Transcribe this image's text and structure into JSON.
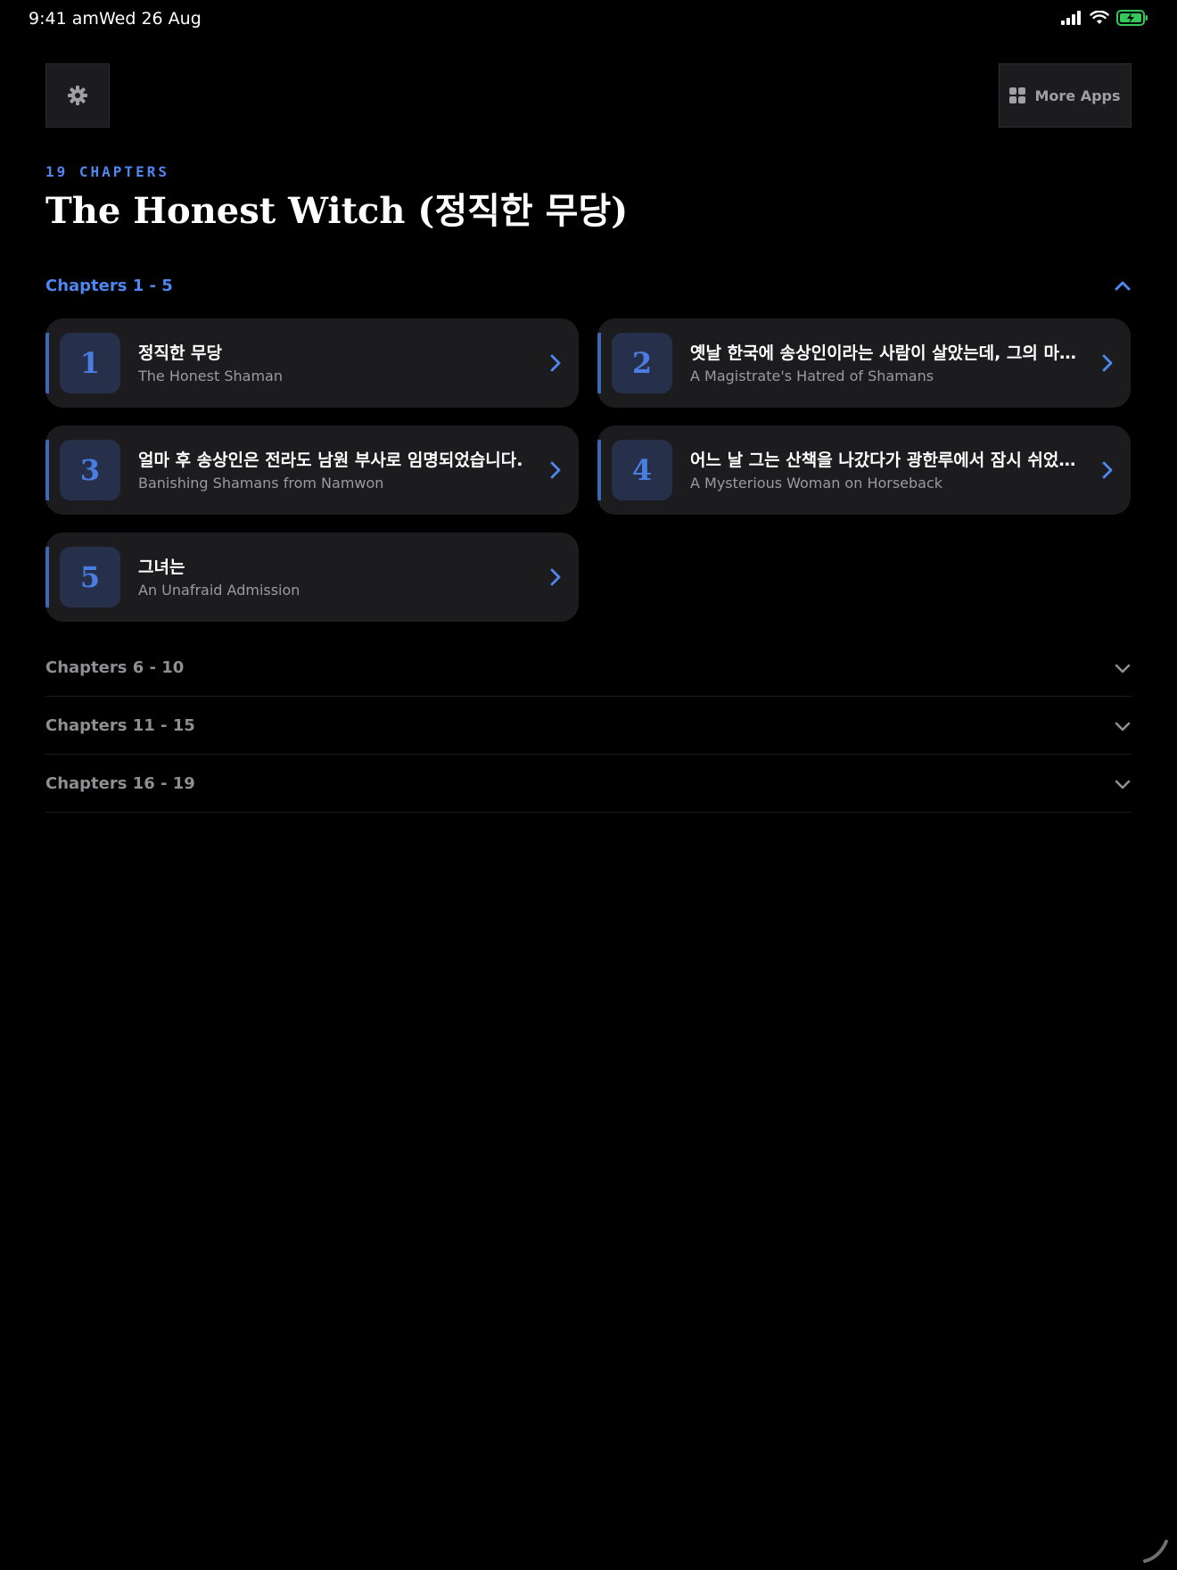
{
  "status_bar": {
    "time": "9:41 am",
    "date": "Wed 26 Aug",
    "icons": [
      "cellular-signal-icon",
      "wifi-icon",
      "battery-charging-icon"
    ]
  },
  "toolbar": {
    "settings_icon": "gear-icon",
    "more_apps_label": "More Apps",
    "more_apps_icon": "grid-icon"
  },
  "header": {
    "chapter_count": "19 CHAPTERS",
    "title": "The Honest Witch (정직한 무당)"
  },
  "sections": [
    {
      "label": "Chapters 1 - 5",
      "expanded": true,
      "chapters": [
        {
          "number": "1",
          "korean": "정직한 무당",
          "english": "The Honest Shaman"
        },
        {
          "number": "2",
          "korean": "옛날 한국에 송상인이라는 사람이 살았는데, 그의 마…",
          "english": "A Magistrate's Hatred of Shamans"
        },
        {
          "number": "3",
          "korean": "얼마 후 송상인은 전라도 남원 부사로 임명되었습니다.",
          "english": "Banishing Shamans from Namwon"
        },
        {
          "number": "4",
          "korean": "어느 날 그는 산책을 나갔다가 광한루에서 잠시 쉬었습…",
          "english": "A Mysterious Woman on Horseback"
        },
        {
          "number": "5",
          "korean": "그녀는",
          "english": "An Unafraid Admission"
        }
      ]
    },
    {
      "label": "Chapters 6 - 10",
      "expanded": false
    },
    {
      "label": "Chapters 11 - 15",
      "expanded": false
    },
    {
      "label": "Chapters 16 - 19",
      "expanded": false
    }
  ],
  "colors": {
    "accent": "#4f86f0",
    "background": "#000000",
    "card": "#1c1c1e",
    "muted_text": "#9a9aa0",
    "battery_green": "#34c759"
  }
}
